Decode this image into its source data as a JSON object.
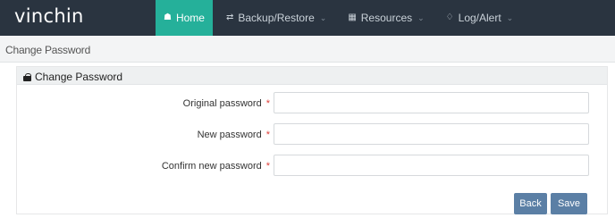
{
  "app": {
    "brand": "vinchin"
  },
  "nav": {
    "items": [
      {
        "label": "Home",
        "icon": "home-icon",
        "active": true
      },
      {
        "label": "Backup/Restore",
        "icon": "backup-restore-icon",
        "active": false
      },
      {
        "label": "Resources",
        "icon": "resources-icon",
        "active": false
      },
      {
        "label": "Log/Alert",
        "icon": "bell-icon",
        "active": false
      }
    ]
  },
  "breadcrumb": {
    "current": "Change Password"
  },
  "panel": {
    "title": "Change Password",
    "icon": "key-lock-icon"
  },
  "form": {
    "fields": [
      {
        "label": "Original password",
        "required_marker": "*",
        "value": ""
      },
      {
        "label": "New password",
        "required_marker": "*",
        "value": ""
      },
      {
        "label": "Confirm new password",
        "required_marker": "*",
        "value": ""
      }
    ]
  },
  "actions": {
    "back_label": "Back",
    "save_label": "Save"
  },
  "colors": {
    "topbar": "#2a3440",
    "accent": "#25b09a",
    "button": "#5b7fa5",
    "required": "#e0403a"
  }
}
